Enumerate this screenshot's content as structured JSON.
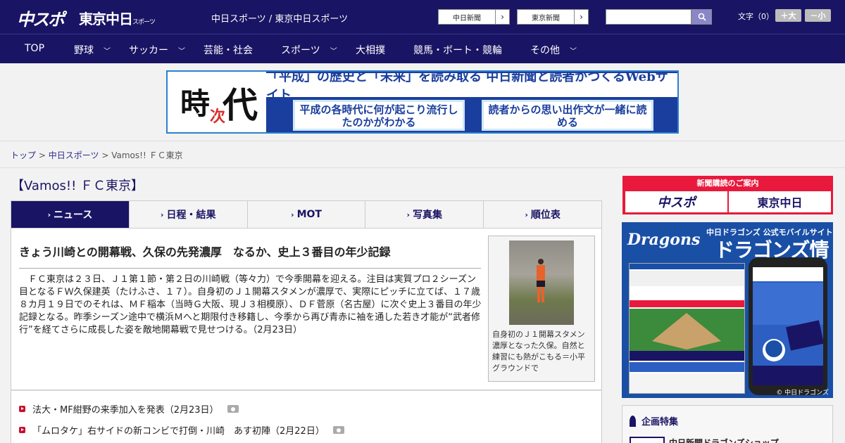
{
  "header": {
    "logo_chuspo": "中スポ",
    "logo_tokyo": "東京中日",
    "logo_tokyo_sub": "スポーツ",
    "site_title": "中日スポーツ / 東京中日スポーツ",
    "btn_chunichi": "中日新聞",
    "btn_tokyo": "東京新聞",
    "search_placeholder": "",
    "font_label": "文字（0）",
    "font_plus": "＋大",
    "font_minus": "－小"
  },
  "nav": {
    "items": [
      {
        "label": "TOP",
        "has_menu": false
      },
      {
        "label": "野球",
        "has_menu": true
      },
      {
        "label": "サッカー",
        "has_menu": true
      },
      {
        "label": "芸能・社会",
        "has_menu": false
      },
      {
        "label": "スポーツ",
        "has_menu": true
      },
      {
        "label": "大相撲",
        "has_menu": false
      },
      {
        "label": "競馬・ボート・競輪",
        "has_menu": false
      },
      {
        "label": "その他",
        "has_menu": true
      }
    ]
  },
  "banner": {
    "ji": "時",
    "tsugi": "次",
    "dai": "代",
    "headline": "「平成」の歴史と「未来」を読み取る 中日新聞と読者がつくるWebサイト",
    "box1": "平成の各時代に何が起こり流行したのかがわかる",
    "box2": "読者からの思い出作文が一緒に読める"
  },
  "breadcrumb": {
    "home": "トップ",
    "section": "中日スポーツ",
    "current": "Vamos!! ＦＣ東京",
    "sep": ">"
  },
  "page_title": "【Vamos!! ＦＣ東京】",
  "tabs": [
    {
      "label": "ニュース",
      "active": true
    },
    {
      "label": "日程・結果",
      "active": false
    },
    {
      "label": "MOT",
      "active": false
    },
    {
      "label": "写真集",
      "active": false
    },
    {
      "label": "順位表",
      "active": false
    }
  ],
  "article": {
    "headline": "きょう川崎との開幕戦、久保の先発濃厚　なるか、史上３番目の年少記録",
    "body": "　ＦＣ東京は２３日、Ｊ１第１節・第２日の川崎戦（等々力）で今季開幕を迎える。注目は実質プロ２シーズン目となるＦＷ久保建英（たけふさ、１７）。自身初のＪ１開幕スタメンが濃厚で、実際にピッチに立てば、１７歳８カ月１９日でのそれは、ＭＦ稲本（当時Ｇ大阪、現Ｊ３相模原）、ＤＦ菅原（名古屋）に次ぐ史上３番目の年少記録となる。昨季シーズン途中で横浜Ｍへと期限付き移籍し、今季から再び青赤に袖を通した若き才能が“武者修行”を経てさらに成長した姿を敵地開幕戦で見せつける。（2月23日）",
    "caption": "自身初のＪ１開幕スタメン濃厚となった久保。自然と練習にも熱がこもる＝小平グラウンドで"
  },
  "news": [
    {
      "text": "法大・MF紺野の来季加入を発表（2月23日）",
      "has_photo": true
    },
    {
      "text": "「ムロタケ」右サイドの新コンビで打倒・川崎　あす初陣（2月22日）",
      "has_photo": true
    }
  ],
  "sidebar": {
    "subscribe_head": "新聞購読のご案内",
    "sub_logo1": "中スポ",
    "sub_logo2": "東京中日",
    "dragons_top": "中日ドラゴンズ 公式モバイルサイト",
    "dragons_big": "ドラゴンズ情報",
    "dragons_script": "Dragons",
    "dragons_copy": "© 中日ドラゴンズ",
    "plan_title": "企画特集",
    "plan_link": "中日新聞ドラゴンズショップ"
  },
  "colors": {
    "header_bg": "#1a1464",
    "accent_red": "#c8102e",
    "banner_blue": "#1a3e9e"
  }
}
